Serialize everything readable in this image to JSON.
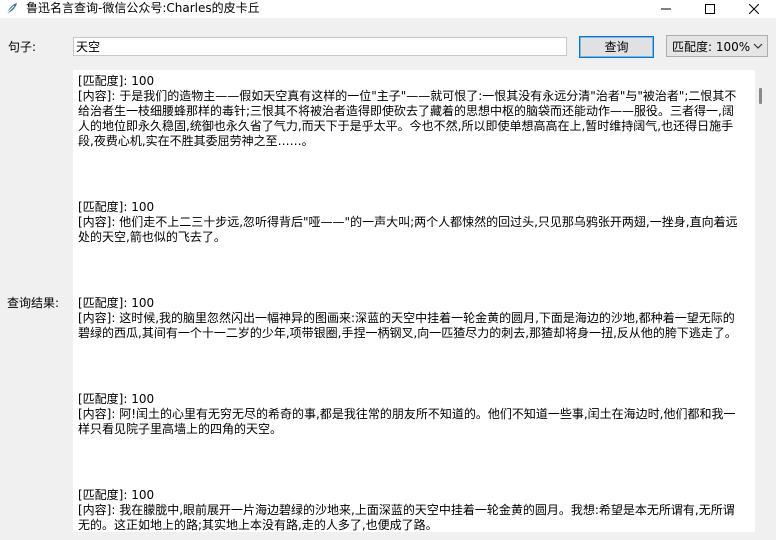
{
  "window": {
    "title": "鲁迅名言查询-微信公众号:Charles的皮卡丘",
    "minimize_icon": "minimize-icon",
    "maximize_icon": "maximize-icon",
    "close_icon": "close-icon"
  },
  "query": {
    "sentence_label": "句子:",
    "sentence_value": "天空",
    "query_button": "查询",
    "match_select_value": "匹配度: 100%"
  },
  "results": {
    "label": "查询结果:",
    "entries": [
      {
        "match": "[匹配度]: 100",
        "content": "[内容]: 于是我们的造物主——假如天空真有这样的一位\"主子\"——就可恨了:一恨其没有永远分清\"治者\"与\"被治者\";二恨其不给治者生一枝细腰蜂那样的毒针;三恨其不将被治者造得即使砍去了藏着的思想中枢的脑袋而还能动作——服役。三者得一,阔人的地位即永久稳固,统御也永久省了气力,而天下于是乎太平。今也不然,所以即使单想高高在上,暂时维持阔气,也还得日施手段,夜费心机,实在不胜其委屈劳神之至……。"
      },
      {
        "match": "[匹配度]: 100",
        "content": "[内容]: 他们走不上二三十步远,忽听得背后\"哑——\"的一声大叫;两个人都悚然的回过头,只见那乌鸦张开两翅,一挫身,直向着远处的天空,箭也似的飞去了。"
      },
      {
        "match": "[匹配度]: 100",
        "content": "[内容]: 这时候,我的脑里忽然闪出一幅神异的图画来:深蓝的天空中挂着一轮金黄的圆月,下面是海边的沙地,都种着一望无际的碧绿的西瓜,其间有一个十一二岁的少年,项带银圈,手捏一柄钢叉,向一匹猹尽力的刺去,那猹却将身一扭,反从他的胯下逃走了。"
      },
      {
        "match": "[匹配度]: 100",
        "content": "[内容]: 阿!闰土的心里有无穷无尽的希奇的事,都是我往常的朋友所不知道的。他们不知道一些事,闰土在海边时,他们都和我一样只看见院子里高墙上的四角的天空。"
      },
      {
        "match": "[匹配度]: 100",
        "content": "[内容]: 我在朦胧中,眼前展开一片海边碧绿的沙地来,上面深蓝的天空中挂着一轮金黄的圆月。我想:希望是本无所谓有,无所谓无的。这正如地上的路;其实地上本没有路,走的人多了,也便成了路。"
      }
    ]
  }
}
